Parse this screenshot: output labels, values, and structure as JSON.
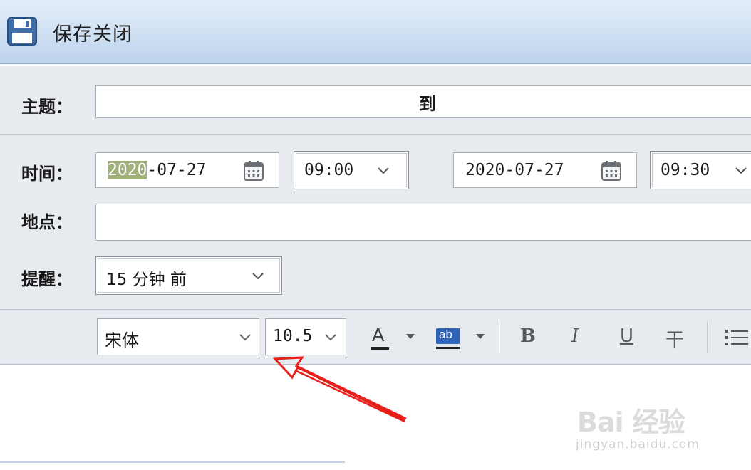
{
  "title_bar": {
    "save_label": "保存关闭",
    "icon": "save-icon"
  },
  "form": {
    "subject": {
      "label": "主题：",
      "value": ""
    },
    "time": {
      "label": "时间：",
      "start_date_highlight": "2020",
      "start_date_rest": "-07-27",
      "start_time": "09:00",
      "to_label": "到",
      "end_date": "2020-07-27",
      "end_time": "09:30"
    },
    "location": {
      "label": "地点：",
      "value": ""
    },
    "reminder": {
      "label": "提醒：",
      "value": "15 分钟 前"
    }
  },
  "toolbar": {
    "font_family": "宋体",
    "font_size": "10.5",
    "font_color_label": "A",
    "highlight_label": "ab",
    "bold_label": "B",
    "italic_label": "I",
    "underline_label": "U",
    "strikethrough_label": "干"
  },
  "watermark": {
    "logo": "Bai 经验",
    "url": "jingyan.baidu.com"
  },
  "colors": {
    "title_gradient_top": "#e4eefa",
    "title_gradient_bottom": "#bdd3ec",
    "form_bg": "#e7ebf0",
    "date_highlight": "#9fb07a",
    "annotation_arrow": "#e8201c"
  }
}
